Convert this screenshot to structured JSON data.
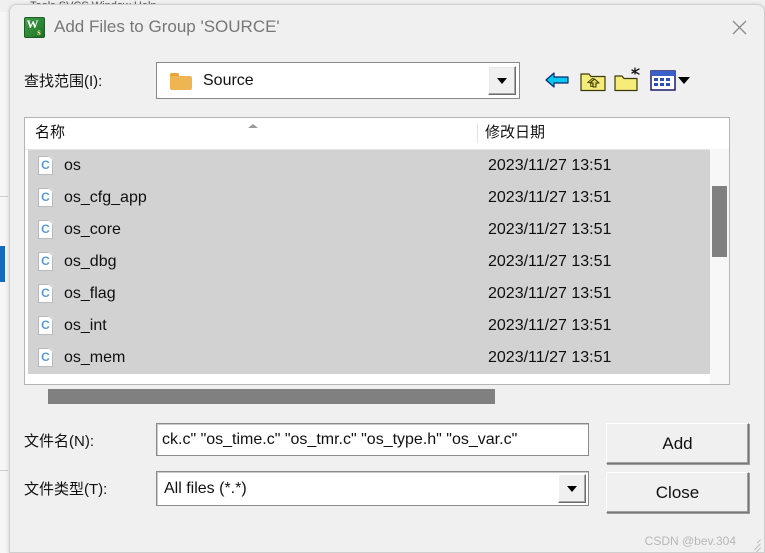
{
  "backdrop": {
    "menubar_text": "Tools  SVCS  Window  Help"
  },
  "titlebar": {
    "title": "Add Files to Group 'SOURCE'",
    "app_icon_main": "W",
    "app_icon_sub": "s",
    "app_icon_name": "keil-uvision-icon",
    "close_label": "×"
  },
  "lookin": {
    "label": "查找范围(I):",
    "value": "Source",
    "folder_icon": "folder-icon",
    "dropdown_icon": "chevron-down-icon"
  },
  "toolbar": {
    "buttons": [
      {
        "name": "back-button",
        "icon": "back-arrow-icon"
      },
      {
        "name": "up-one-level-button",
        "icon": "folder-up-icon"
      },
      {
        "name": "create-new-folder-button",
        "icon": "new-folder-icon"
      },
      {
        "name": "views-button",
        "icon": "views-grid-icon"
      },
      {
        "name": "views-dropdown-button",
        "icon": "chevron-down-icon"
      }
    ]
  },
  "filelist": {
    "columns": [
      "名称",
      "修改日期"
    ],
    "sort_indicator": "ascending",
    "rows": [
      {
        "icon": "C",
        "name": "os",
        "date": "2023/11/27 13:51",
        "selected": true
      },
      {
        "icon": "C",
        "name": "os_cfg_app",
        "date": "2023/11/27 13:51",
        "selected": true
      },
      {
        "icon": "C",
        "name": "os_core",
        "date": "2023/11/27 13:51",
        "selected": true
      },
      {
        "icon": "C",
        "name": "os_dbg",
        "date": "2023/11/27 13:51",
        "selected": true
      },
      {
        "icon": "C",
        "name": "os_flag",
        "date": "2023/11/27 13:51",
        "selected": true
      },
      {
        "icon": "C",
        "name": "os_int",
        "date": "2023/11/27 13:51",
        "selected": true
      },
      {
        "icon": "C",
        "name": "os_mem",
        "date": "2023/11/27 13:51",
        "selected": true
      }
    ]
  },
  "form": {
    "filename_label": "文件名(N):",
    "filename_value": "ck.c\" \"os_time.c\" \"os_tmr.c\" \"os_type.h\" \"os_var.c\"",
    "filetype_label": "文件类型(T):",
    "filetype_value": "All files (*.*)",
    "filetype_dropdown_icon": "chevron-down-icon"
  },
  "buttons": {
    "add_label": "Add",
    "close_label": "Close"
  },
  "watermark": {
    "text": "CSDN @bev.304"
  },
  "colors": {
    "dialog_bg": "#f0f0f0",
    "selection_gray": "#d2d2d2",
    "scroll_thumb": "#808080",
    "accent_blue": "#1669c1",
    "icon_green": "#2f8a38",
    "folder_yellow": "#f0b553",
    "c_icon_blue": "#5b9bd5"
  }
}
